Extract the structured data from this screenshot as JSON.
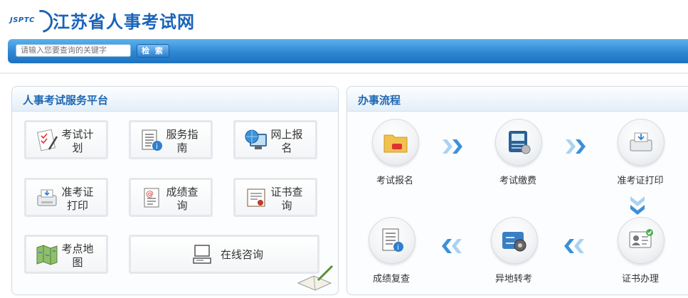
{
  "header": {
    "logo_text": "JSPTC",
    "site_title": "江苏省人事考试网"
  },
  "search": {
    "placeholder": "请输入您要查询的关键字",
    "button_label": "检 索"
  },
  "left_panel": {
    "title": "人事考试服务平台",
    "tiles": [
      {
        "label": "考试计划",
        "icon": "exam-plan-icon"
      },
      {
        "label": "服务指南",
        "icon": "service-guide-icon"
      },
      {
        "label": "网上报名",
        "icon": "online-registration-icon"
      },
      {
        "label": "准考证打印",
        "icon": "printer-icon"
      },
      {
        "label": "成绩查询",
        "icon": "score-query-icon"
      },
      {
        "label": "证书查询",
        "icon": "certificate-icon"
      },
      {
        "label": "考点地图",
        "icon": "map-icon"
      },
      {
        "label": "在线咨询",
        "icon": "computer-icon"
      }
    ]
  },
  "right_panel": {
    "title": "办事流程",
    "steps": [
      {
        "label": "考试报名",
        "icon": "folder-icon"
      },
      {
        "label": "考试缴费",
        "icon": "payment-terminal-icon"
      },
      {
        "label": "准考证打印",
        "icon": "printer-icon"
      },
      {
        "label": "证书办理",
        "icon": "id-card-icon"
      },
      {
        "label": "异地转考",
        "icon": "transfer-icon"
      },
      {
        "label": "成绩复查",
        "icon": "document-icon"
      }
    ]
  },
  "colors": {
    "brand_blue": "#1a63b8",
    "searchbar_blue": "#2e86d3",
    "arrow_blue": "#59a7e6"
  }
}
